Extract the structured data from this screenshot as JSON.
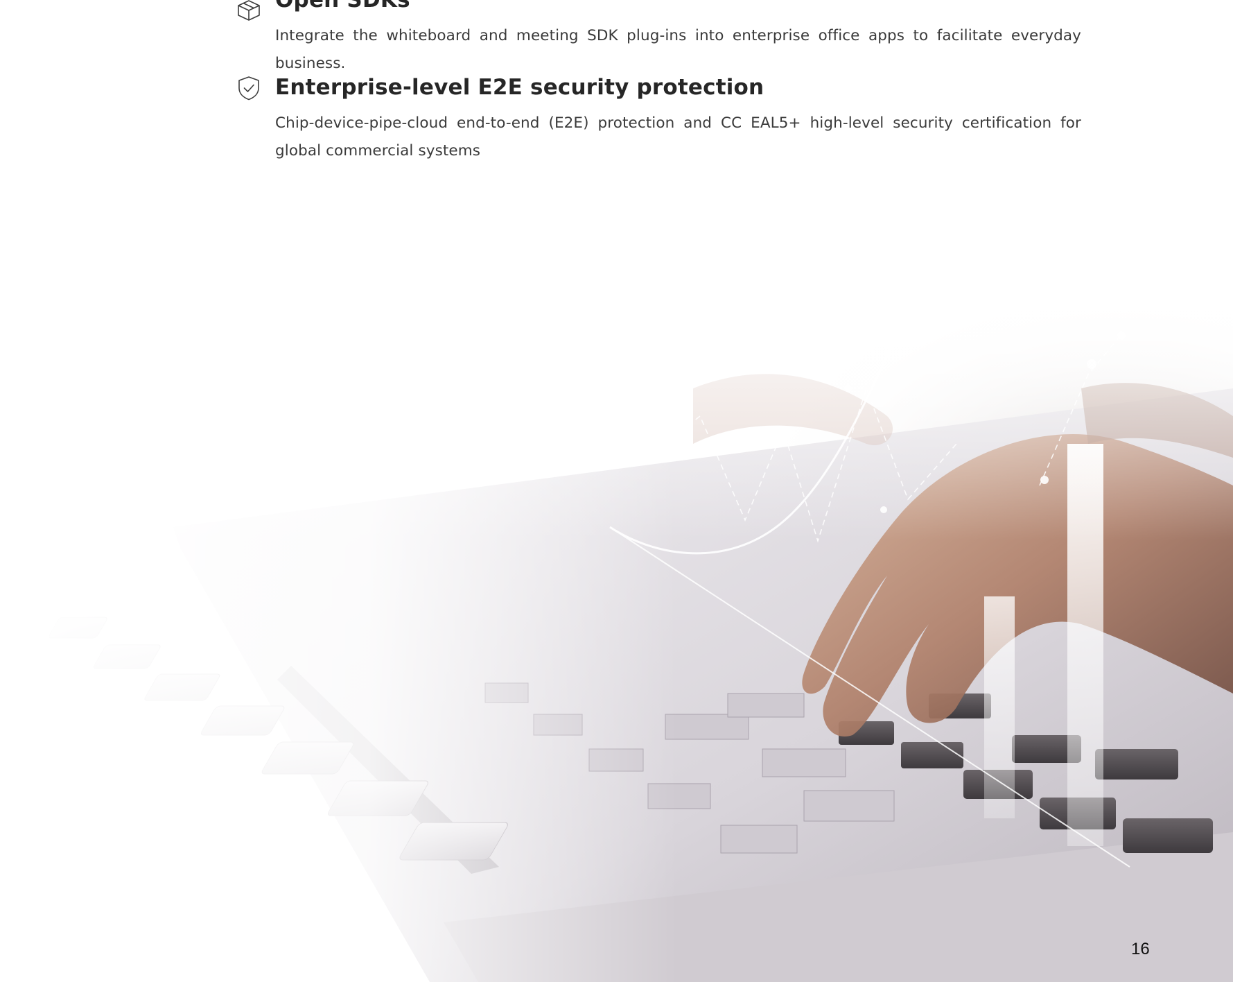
{
  "features": [
    {
      "icon": "package-box-icon",
      "title": "Open SDKs",
      "description": "Integrate the whiteboard and meeting SDK plug-ins into enterprise office apps to facilitate everyday business."
    },
    {
      "icon": "shield-check-icon",
      "title": "Enterprise-level E2E security protection",
      "description": "Chip-device-pipe-cloud end-to-end (E2E) protection and CC EAL5+ high-level security certification for global commercial systems"
    }
  ],
  "page_number": "16",
  "colors": {
    "heading": "#262626",
    "body_text": "#3a3a3a",
    "icon_stroke": "#3c3c3c"
  }
}
